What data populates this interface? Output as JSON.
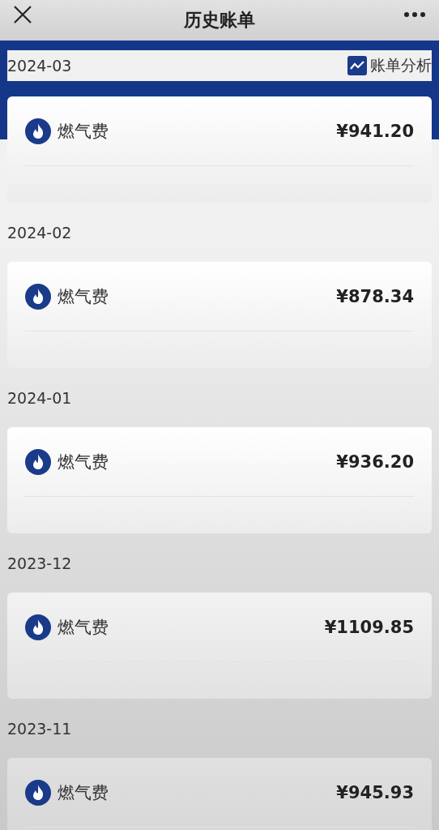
{
  "nav": {
    "title": "历史账单"
  },
  "analysis_button": {
    "label": "账单分析"
  },
  "months": [
    {
      "month": "2024-03",
      "bill": {
        "name": "燃气费",
        "amount": "¥941.20"
      }
    },
    {
      "month": "2024-02",
      "bill": {
        "name": "燃气费",
        "amount": "¥878.34"
      }
    },
    {
      "month": "2024-01",
      "bill": {
        "name": "燃气费",
        "amount": "¥936.20"
      }
    },
    {
      "month": "2023-12",
      "bill": {
        "name": "燃气费",
        "amount": "¥1109.85"
      }
    },
    {
      "month": "2023-11",
      "bill": {
        "name": "燃气费",
        "amount": "¥945.93"
      }
    }
  ]
}
